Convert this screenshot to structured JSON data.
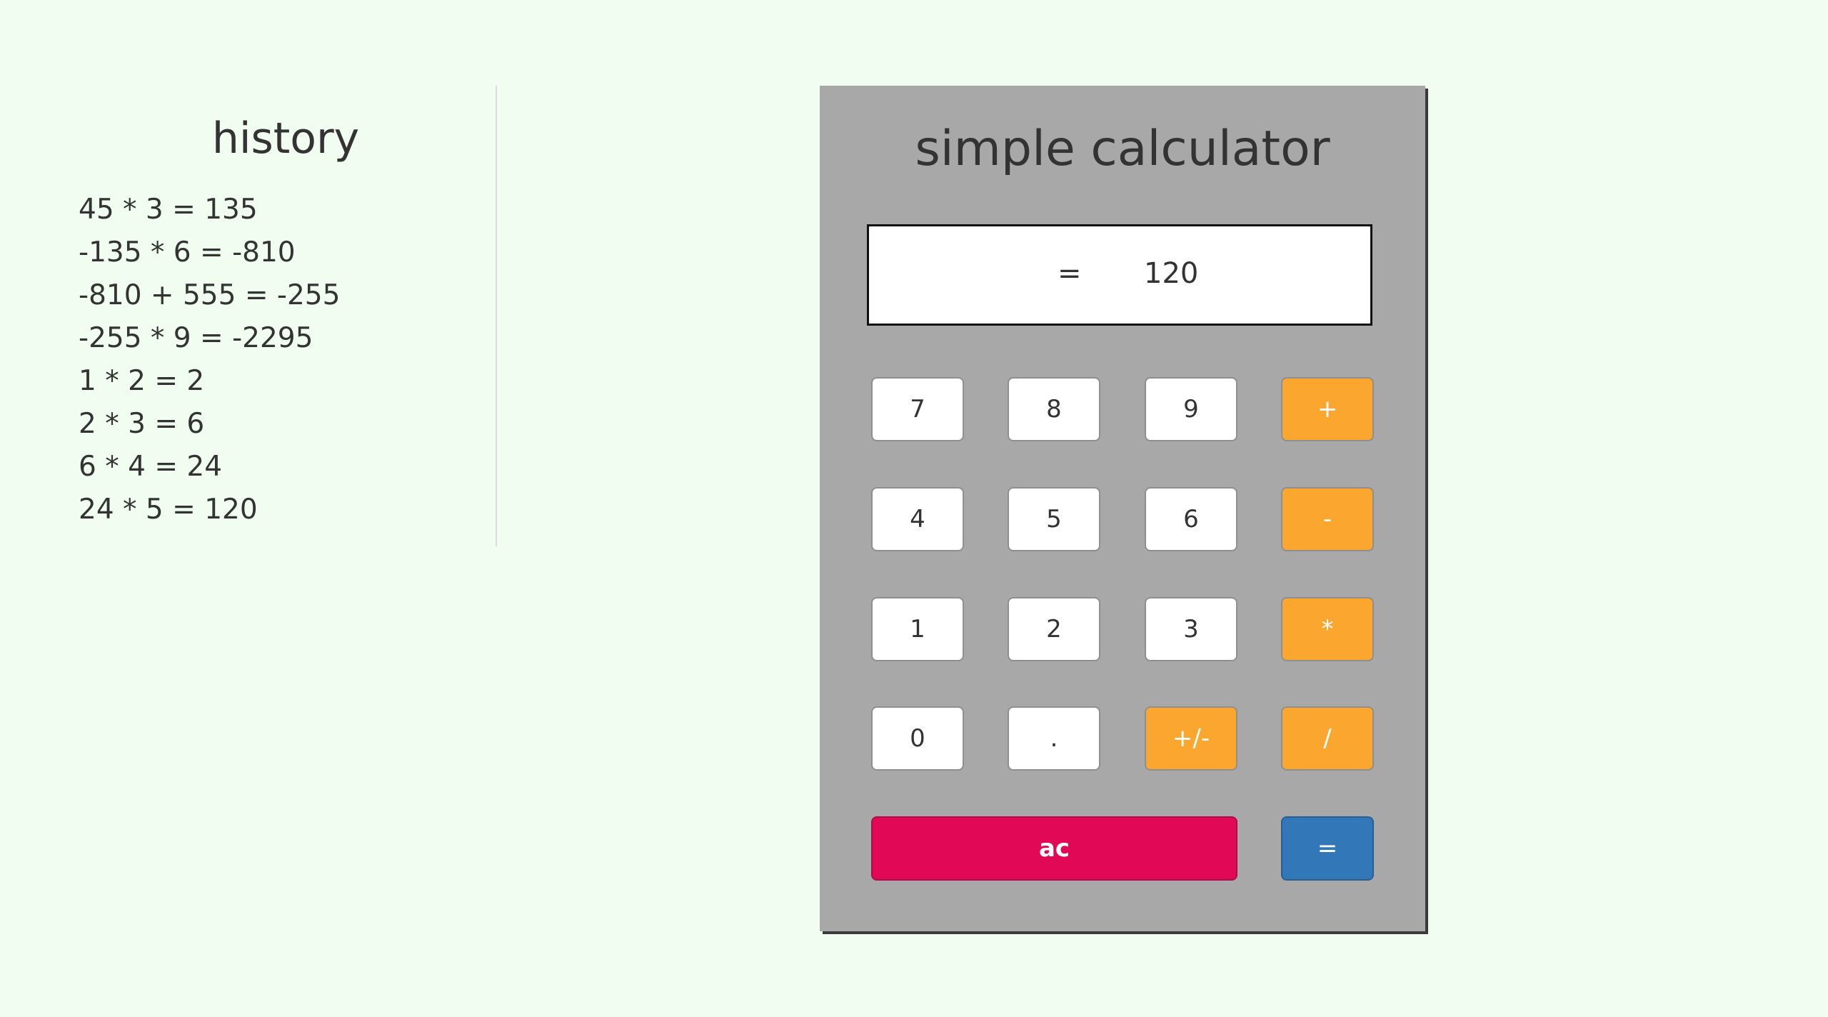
{
  "colors": {
    "page_background": "#f0fdf0",
    "calculator_background": "#a8a8a8",
    "operator_key": "#fba62f",
    "clear_key": "#e10856",
    "equals_key": "#3278b8",
    "number_key": "#ffffff",
    "text": "#333333"
  },
  "history": {
    "title": "history",
    "items": [
      "45 * 3 = 135",
      "-135 * 6 = -810",
      "-810 + 555 = -255",
      "-255 * 9 = -2295",
      "1 * 2 = 2",
      "2 * 3 = 6",
      "6 * 4 = 24",
      "24 * 5 = 120"
    ]
  },
  "calculator": {
    "title": "simple calculator",
    "display": {
      "operator": "=",
      "value": "120"
    },
    "keys": {
      "seven": "7",
      "eight": "8",
      "nine": "9",
      "plus": "+",
      "four": "4",
      "five": "5",
      "six": "6",
      "minus": "-",
      "one": "1",
      "two": "2",
      "three": "3",
      "multiply": "*",
      "zero": "0",
      "decimal": ".",
      "negate": "+/-",
      "divide": "/",
      "clear": "ac",
      "equals": "="
    }
  }
}
